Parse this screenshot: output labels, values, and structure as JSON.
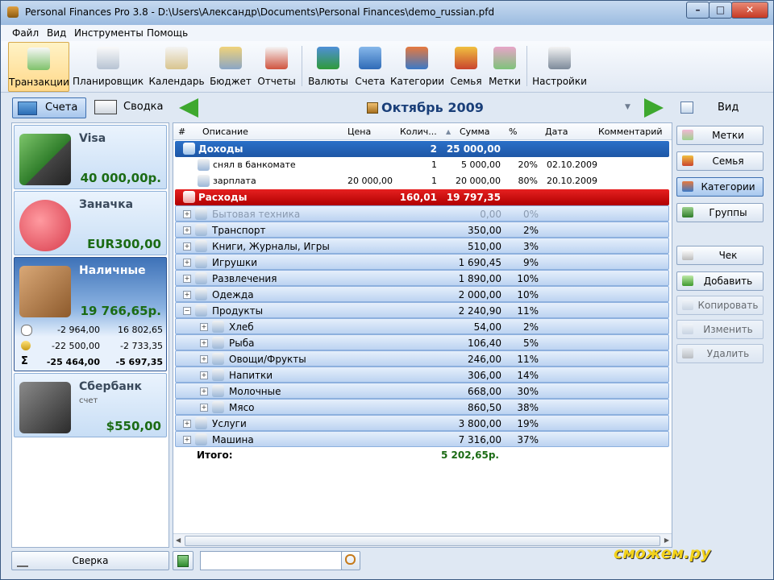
{
  "window": {
    "title": "Personal Finances Pro 3.8 - D:\\Users\\Александр\\Documents\\Personal Finances\\demo_russian.pfd",
    "min": "–",
    "max": "□",
    "close": "✕"
  },
  "menu": [
    "Файл",
    "Вид",
    "Инструменты",
    "Помощь"
  ],
  "toolbar": [
    {
      "label": "Транзакции",
      "icon": "transactions-icon",
      "selected": true
    },
    {
      "label": "Планировщик",
      "icon": "scheduler-icon"
    },
    {
      "label": "Календарь",
      "icon": "calendar-icon"
    },
    {
      "label": "Бюджет",
      "icon": "budget-icon"
    },
    {
      "label": "Отчеты",
      "icon": "reports-icon"
    },
    {
      "label": "Валюты",
      "icon": "currency-icon"
    },
    {
      "label": "Счета",
      "icon": "accounts-icon"
    },
    {
      "label": "Категории",
      "icon": "categories-icon"
    },
    {
      "label": "Семья",
      "icon": "family-icon"
    },
    {
      "label": "Метки",
      "icon": "tags-icon"
    },
    {
      "label": "Настройки",
      "icon": "settings-icon"
    }
  ],
  "nav": {
    "accounts": "Счета",
    "summary": "Сводка",
    "month": "Октябрь 2009",
    "view": "Вид"
  },
  "accounts": [
    {
      "name": "Visa",
      "balance": "40 000,00р.",
      "icon": "money-cards-icon"
    },
    {
      "name": "Заначка",
      "balance": "EUR300,00",
      "icon": "piggy-bank-icon"
    },
    {
      "name": "Наличные",
      "balance": "19 766,65р.",
      "icon": "wallet-icon",
      "selected": true,
      "details": [
        {
          "icon": "clock-icon",
          "a": "-2 964,00",
          "b": "16 802,65"
        },
        {
          "icon": "coins-icon",
          "a": "-22 500,00",
          "b": "-2 733,35"
        },
        {
          "icon": "sigma-icon",
          "a": "-25 464,00",
          "b": "-5 697,35"
        }
      ]
    },
    {
      "name": "Сбербанк",
      "sub": "счет",
      "balance": "$550,00",
      "icon": "safe-icon"
    }
  ],
  "table": {
    "columns": [
      "#",
      "Описание",
      "Цена",
      "Колич...",
      "Сумма",
      "%",
      "Дата",
      "Комментарий"
    ],
    "rows": [
      {
        "kind": "income",
        "desc": "Доходы",
        "qty": "2",
        "sum": "25 000,00",
        "icon": "income-icon"
      },
      {
        "kind": "plain",
        "desc": "снял в банкомате",
        "qty": "1",
        "sum": "5 000,00",
        "pct": "20%",
        "date": "02.10.2009",
        "icon": "transfer-icon"
      },
      {
        "kind": "plain",
        "desc": "зарплата",
        "price": "20 000,00",
        "qty": "1",
        "sum": "20 000,00",
        "pct": "80%",
        "date": "20.10.2009",
        "icon": "salary-icon"
      },
      {
        "kind": "expense",
        "desc": "Расходы",
        "qty": "160,01",
        "sum": "19 797,35",
        "icon": "expense-icon"
      },
      {
        "kind": "grp",
        "level": 1,
        "desc": "Бытовая техника",
        "sum": "0,00",
        "pct": "0%",
        "muted": true,
        "icon": "appliance-icon"
      },
      {
        "kind": "grp",
        "level": 1,
        "desc": "Транспорт",
        "sum": "350,00",
        "pct": "2%",
        "icon": "bus-icon"
      },
      {
        "kind": "grp",
        "level": 1,
        "desc": "Книги, Журналы, Игры",
        "sum": "510,00",
        "pct": "3%",
        "icon": "book-icon"
      },
      {
        "kind": "grp",
        "level": 1,
        "desc": "Игрушки",
        "sum": "1 690,45",
        "pct": "9%",
        "icon": "toy-icon"
      },
      {
        "kind": "grp",
        "level": 1,
        "desc": "Развлечения",
        "sum": "1 890,00",
        "pct": "10%",
        "icon": "entertainment-icon"
      },
      {
        "kind": "grp",
        "level": 1,
        "desc": "Одежда",
        "sum": "2 000,00",
        "pct": "10%",
        "icon": "clothes-icon"
      },
      {
        "kind": "grp",
        "level": 1,
        "desc": "Продукты",
        "sum": "2 240,90",
        "pct": "11%",
        "expanded": true,
        "icon": "groceries-icon"
      },
      {
        "kind": "grp",
        "level": 2,
        "desc": "Хлеб",
        "sum": "54,00",
        "pct": "2%",
        "icon": "bread-icon"
      },
      {
        "kind": "grp",
        "level": 2,
        "desc": "Рыба",
        "sum": "106,40",
        "pct": "5%",
        "icon": "fish-icon"
      },
      {
        "kind": "grp",
        "level": 2,
        "desc": "Овощи/Фрукты",
        "sum": "246,00",
        "pct": "11%",
        "icon": "apple-icon"
      },
      {
        "kind": "grp",
        "level": 2,
        "desc": "Напитки",
        "sum": "306,00",
        "pct": "14%",
        "icon": "drink-icon"
      },
      {
        "kind": "grp",
        "level": 2,
        "desc": "Молочные",
        "sum": "668,00",
        "pct": "30%",
        "icon": "milk-icon"
      },
      {
        "kind": "grp",
        "level": 2,
        "desc": "Мясо",
        "sum": "860,50",
        "pct": "38%",
        "icon": "meat-icon"
      },
      {
        "kind": "grp",
        "level": 1,
        "desc": "Услуги",
        "sum": "3 800,00",
        "pct": "19%",
        "icon": "services-icon"
      },
      {
        "kind": "grp",
        "level": 1,
        "desc": "Машина",
        "sum": "7 316,00",
        "pct": "37%",
        "icon": "car-icon"
      }
    ],
    "total_label": "Итого:",
    "total_value": "5 202,65р."
  },
  "right_buttons": [
    {
      "label": "Метки",
      "icon": "tags-icon"
    },
    {
      "label": "Семья",
      "icon": "family-icon"
    },
    {
      "label": "Категории",
      "icon": "categories-icon",
      "selected": true
    },
    {
      "label": "Группы",
      "icon": "groups-icon"
    },
    {
      "label": "Чек",
      "icon": "receipt-icon"
    },
    {
      "label": "Добавить",
      "icon": "add-icon"
    },
    {
      "label": "Копировать",
      "icon": "copy-icon",
      "disabled": true
    },
    {
      "label": "Изменить",
      "icon": "edit-icon",
      "disabled": true
    },
    {
      "label": "Удалить",
      "icon": "delete-icon",
      "disabled": true
    }
  ],
  "bottom": {
    "reconcile": "Сверка",
    "search_value": "",
    "watermark": "сможем.ру"
  },
  "colors": {
    "income": "#1e57a6",
    "expense": "#c00000",
    "balance": "#1b6b14",
    "month": "#1a3f79"
  }
}
